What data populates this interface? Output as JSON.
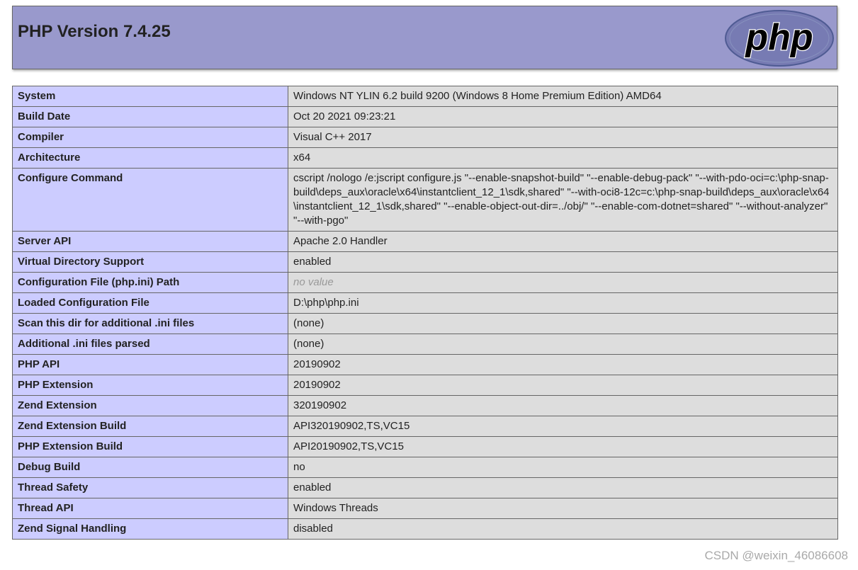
{
  "header": {
    "title": "PHP Version 7.4.25",
    "logo_text": "php"
  },
  "rows": [
    {
      "key": "System",
      "value": "Windows NT YLIN 6.2 build 9200 (Windows 8 Home Premium Edition) AMD64"
    },
    {
      "key": "Build Date",
      "value": "Oct 20 2021 09:23:21"
    },
    {
      "key": "Compiler",
      "value": "Visual C++ 2017"
    },
    {
      "key": "Architecture",
      "value": "x64"
    },
    {
      "key": "Configure Command",
      "value": "cscript /nologo /e:jscript configure.js \"--enable-snapshot-build\" \"--enable-debug-pack\" \"--with-pdo-oci=c:\\php-snap-build\\deps_aux\\oracle\\x64\\instantclient_12_1\\sdk,shared\" \"--with-oci8-12c=c:\\php-snap-build\\deps_aux\\oracle\\x64\\instantclient_12_1\\sdk,shared\" \"--enable-object-out-dir=../obj/\" \"--enable-com-dotnet=shared\" \"--without-analyzer\" \"--with-pgo\""
    },
    {
      "key": "Server API",
      "value": "Apache 2.0 Handler"
    },
    {
      "key": "Virtual Directory Support",
      "value": "enabled"
    },
    {
      "key": "Configuration File (php.ini) Path",
      "value": "no value",
      "novalue": true
    },
    {
      "key": "Loaded Configuration File",
      "value": "D:\\php\\php.ini"
    },
    {
      "key": "Scan this dir for additional .ini files",
      "value": "(none)"
    },
    {
      "key": "Additional .ini files parsed",
      "value": "(none)"
    },
    {
      "key": "PHP API",
      "value": "20190902"
    },
    {
      "key": "PHP Extension",
      "value": "20190902"
    },
    {
      "key": "Zend Extension",
      "value": "320190902"
    },
    {
      "key": "Zend Extension Build",
      "value": "API320190902,TS,VC15"
    },
    {
      "key": "PHP Extension Build",
      "value": "API20190902,TS,VC15"
    },
    {
      "key": "Debug Build",
      "value": "no"
    },
    {
      "key": "Thread Safety",
      "value": "enabled"
    },
    {
      "key": "Thread API",
      "value": "Windows Threads"
    },
    {
      "key": "Zend Signal Handling",
      "value": "disabled"
    }
  ],
  "watermark": "CSDN @weixin_46086608",
  "colors": {
    "header_bg": "#9999cc",
    "key_bg": "#ccccff",
    "value_bg": "#dddddd",
    "logo_bg": "#777bb3"
  }
}
